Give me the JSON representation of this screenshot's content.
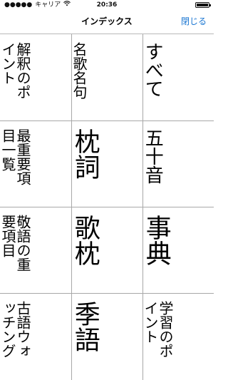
{
  "statusbar": {
    "carrier": "キャリア",
    "time": "20:36"
  },
  "navbar": {
    "title": "インデックス",
    "close_label": "閉じる"
  },
  "grid": {
    "cells": [
      {
        "row": 0,
        "col": 0,
        "text": "解釈のポ\nイント",
        "size": "small"
      },
      {
        "row": 0,
        "col": 1,
        "text": "名歌名句",
        "size": "small"
      },
      {
        "row": 0,
        "col": 2,
        "text": "すべて",
        "size": "medium"
      },
      {
        "row": 1,
        "col": 0,
        "text": "最重要項\n目一覧",
        "size": "small"
      },
      {
        "row": 1,
        "col": 1,
        "text": "枕詞",
        "size": "big"
      },
      {
        "row": 1,
        "col": 2,
        "text": "五十音",
        "size": "medium"
      },
      {
        "row": 2,
        "col": 0,
        "text": "敬語の重\n要項目",
        "size": "small"
      },
      {
        "row": 2,
        "col": 1,
        "text": "歌枕",
        "size": "big"
      },
      {
        "row": 2,
        "col": 2,
        "text": "事典",
        "size": "big"
      },
      {
        "row": 3,
        "col": 0,
        "text": "古語ウォ\nッチング",
        "size": "small"
      },
      {
        "row": 3,
        "col": 1,
        "text": "季語",
        "size": "big"
      },
      {
        "row": 3,
        "col": 2,
        "text": "学習のポ\nイント",
        "size": "small"
      }
    ]
  }
}
